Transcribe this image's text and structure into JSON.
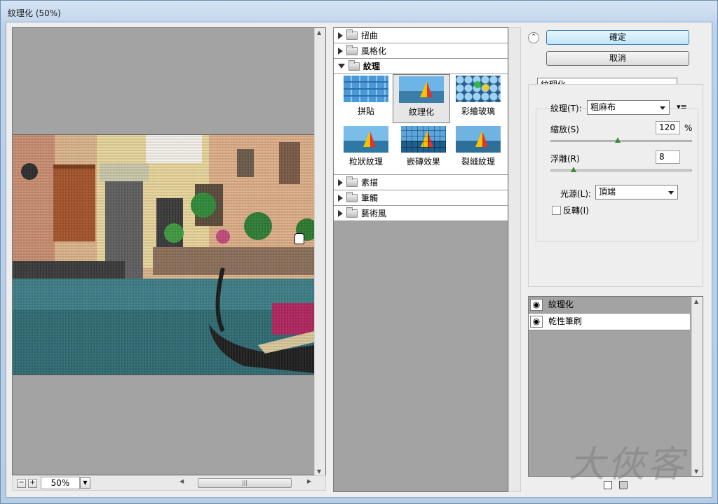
{
  "window": {
    "title": "紋理化 (50%)"
  },
  "preview": {
    "zoom": "50%"
  },
  "gallery": {
    "categories_top": [
      "扭曲",
      "風格化"
    ],
    "open_category": "紋理",
    "filters": [
      "拼貼",
      "紋理化",
      "彩繪玻璃",
      "粒狀紋理",
      "嵌磚效果",
      "裂縫紋理"
    ],
    "selected_filter": "紋理化",
    "categories_bottom": [
      "素描",
      "筆觸",
      "藝術風"
    ]
  },
  "buttons": {
    "ok": "確定",
    "cancel": "取消"
  },
  "settings": {
    "filter_select": "紋理化",
    "texture_label": "紋理(T):",
    "texture_value": "粗麻布",
    "scaling_label": "縮放(S)",
    "scaling_value": "120",
    "scaling_unit": "%",
    "scaling_fraction": 0.47,
    "relief_label": "浮雕(R)",
    "relief_value": "8",
    "relief_fraction": 0.16,
    "light_label": "光源(L):",
    "light_value": "頂端",
    "invert_label": "反轉(I)",
    "invert_checked": false
  },
  "layers": [
    "紋理化",
    "乾性筆刷"
  ],
  "selected_layer": "紋理化",
  "watermark": "大俠客"
}
